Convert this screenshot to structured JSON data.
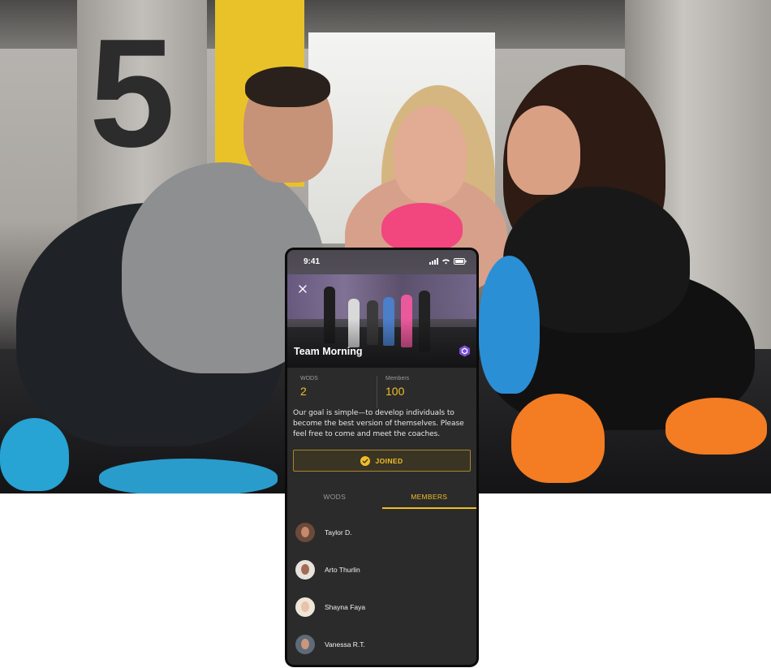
{
  "background": {
    "description_icon": "gym-group-photo",
    "accent_color": "#e9c22a",
    "painted_number": "5"
  },
  "phone": {
    "status_bar": {
      "time": "9:41"
    },
    "group": {
      "name": "Team Morning",
      "stats": [
        {
          "label": "WODS",
          "value": "2"
        },
        {
          "label": "Members",
          "value": "100"
        }
      ],
      "description": "Our goal is simple—to develop individuals to become the best version of themselves. Please feel free to come and meet the coaches.",
      "join_button_label": "JOINED"
    },
    "tabs": [
      {
        "label": "WODS",
        "active": false
      },
      {
        "label": "MEMBERS",
        "active": true
      }
    ],
    "members": [
      {
        "name": "Taylor D."
      },
      {
        "name": "Arto Thurlin"
      },
      {
        "name": "Shayna Faya"
      },
      {
        "name": "Vanessa R.T."
      }
    ],
    "colors": {
      "accent": "#f0be26",
      "screen_bg": "#2b2b2b",
      "badge": "#7b4fd6"
    }
  }
}
